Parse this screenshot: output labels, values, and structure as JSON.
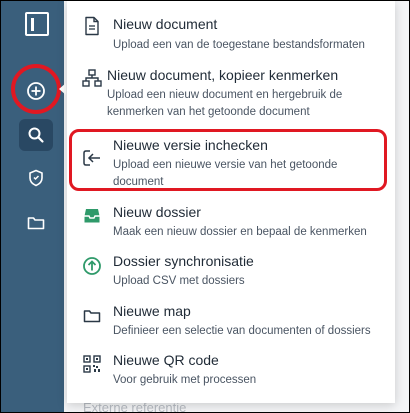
{
  "sidebar": {
    "buttons": [
      {
        "name": "logo",
        "icon": "app-logo-icon"
      },
      {
        "name": "new",
        "icon": "plus-circle-icon"
      },
      {
        "name": "search",
        "icon": "search-icon"
      },
      {
        "name": "security",
        "icon": "shield-icon"
      },
      {
        "name": "folders",
        "icon": "folder-icon"
      }
    ],
    "background_color": "#3a5f7c"
  },
  "menu": {
    "items": [
      {
        "title": "Nieuw document",
        "description": "Upload een van de toegestane bestandsformaten",
        "icon": "document-icon"
      },
      {
        "title": "Nieuw document, kopieer kenmerken",
        "description": "Upload een nieuw document en hergebruik de kenmerken van het getoonde document",
        "icon": "hierarchy-icon"
      },
      {
        "title": "Nieuwe versie inchecken",
        "description": "Upload een nieuwe versie van het getoonde document",
        "icon": "check-in-icon"
      },
      {
        "title": "Nieuw dossier",
        "description": "Maak een nieuw dossier en bepaal de kenmerken",
        "icon": "inbox-icon"
      },
      {
        "title": "Dossier synchronisatie",
        "description": "Upload CSV met dossiers",
        "icon": "upload-circle-icon"
      },
      {
        "title": "Nieuwe map",
        "description": "Definieer een selectie van documenten of dossiers",
        "icon": "folder-icon"
      },
      {
        "title": "Nieuwe QR code",
        "description": "Voor gebruik met processen",
        "icon": "qr-code-icon"
      }
    ]
  },
  "background": {
    "field_label": "Externe referentie"
  },
  "colors": {
    "accent_green": "#2f9a6a",
    "annotation_red": "#e01822",
    "text_dark": "#1f2a36"
  }
}
